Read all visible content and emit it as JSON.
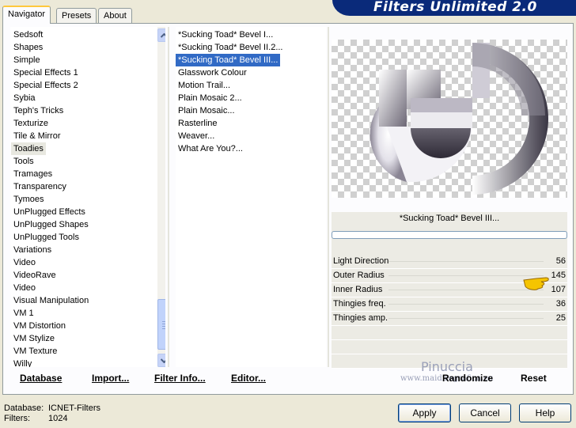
{
  "tabs": [
    "Navigator",
    "Presets",
    "About"
  ],
  "banner_title": "Filters Unlimited 2.0",
  "categories": [
    "Sedsoft",
    "Shapes",
    "Simple",
    "Special Effects 1",
    "Special Effects 2",
    "Sybia",
    "Teph's Tricks",
    "Texturize",
    "Tile & Mirror",
    "Toadies",
    "Tools",
    "Tramages",
    "Transparency",
    "Tymoes",
    "UnPlugged Effects",
    "UnPlugged Shapes",
    "UnPlugged Tools",
    "Variations",
    "Video",
    "VideoRave",
    "Video",
    "Visual Manipulation",
    "VM 1",
    "VM Distortion",
    "VM Stylize",
    "VM Texture",
    "Willy"
  ],
  "selected_category": "Toadies",
  "filters": [
    "*Sucking Toad*  Bevel I...",
    "*Sucking Toad*  Bevel II.2...",
    "*Sucking Toad*  Bevel III...",
    "Glasswork Colour",
    "Motion Trail...",
    "Plain Mosaic 2...",
    "Plain Mosaic...",
    "Rasterline",
    "Weaver...",
    "What Are You?..."
  ],
  "selected_filter": "*Sucking Toad*  Bevel III...",
  "current_filter_name": "*Sucking Toad*  Bevel III...",
  "params": [
    {
      "label": "Light Direction",
      "value": "56"
    },
    {
      "label": "Outer Radius",
      "value": "145"
    },
    {
      "label": "Inner Radius",
      "value": "107"
    },
    {
      "label": "Thingies freq.",
      "value": "36"
    },
    {
      "label": "Thingies amp.",
      "value": "25"
    }
  ],
  "watermark": {
    "name": "Pinuccia",
    "url": "www.maidiregrafica.eu"
  },
  "links": {
    "database": "Database",
    "import": "Import...",
    "filter_info": "Filter Info...",
    "editor": "Editor...",
    "randomize": "Randomize",
    "reset": "Reset"
  },
  "footer": {
    "database_label": "Database:",
    "database_value": "ICNET-Filters",
    "filters_label": "Filters:",
    "filters_value": "1024"
  },
  "buttons": {
    "apply": "Apply",
    "cancel": "Cancel",
    "help": "Help"
  },
  "icons": {
    "scroll_up": "chevron-up-icon",
    "scroll_down": "chevron-down-icon",
    "pointer": "pointing-hand-icon"
  }
}
